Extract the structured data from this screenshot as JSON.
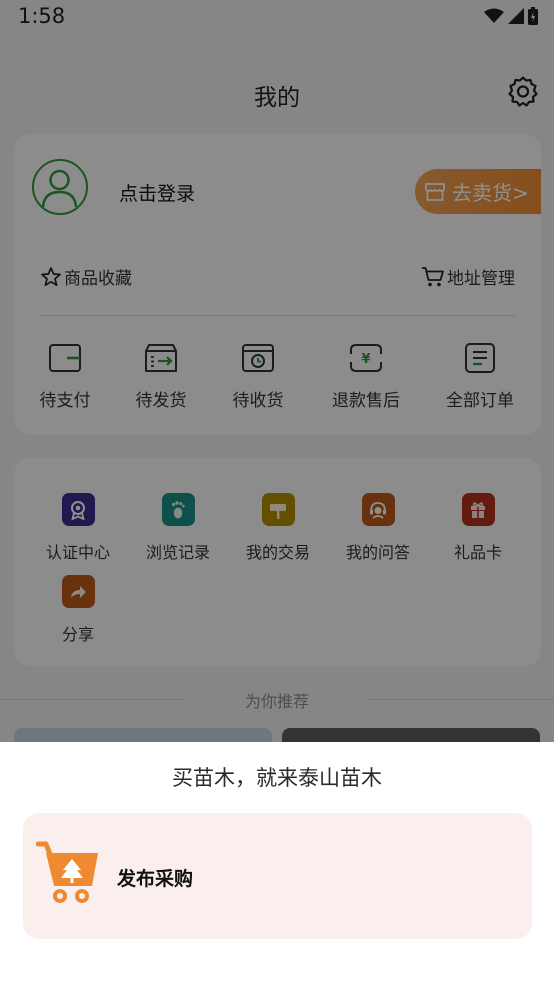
{
  "status_bar": {
    "time": "1:58"
  },
  "header": {
    "title": "我的"
  },
  "account": {
    "login_text": "点击登录",
    "sell_button": "去卖货>",
    "favorites_label": "商品收藏",
    "address_label": "地址管理"
  },
  "orders": [
    {
      "label": "待支付",
      "icon": "wallet-icon"
    },
    {
      "label": "待发货",
      "icon": "shipping-box-icon"
    },
    {
      "label": "待收货",
      "icon": "receive-box-icon"
    },
    {
      "label": "退款售后",
      "icon": "refund-icon"
    },
    {
      "label": "全部订单",
      "icon": "order-list-icon"
    }
  ],
  "services": [
    {
      "label": "认证中心",
      "icon": "certification-icon",
      "color": "#3b2d8f"
    },
    {
      "label": "浏览记录",
      "icon": "footprint-icon",
      "color": "#1d8f84"
    },
    {
      "label": "我的交易",
      "icon": "signpost-icon",
      "color": "#b38c00"
    },
    {
      "label": "我的问答",
      "icon": "customer-service-icon",
      "color": "#b95a1a"
    },
    {
      "label": "礼品卡",
      "icon": "gift-icon",
      "color": "#b3321c"
    },
    {
      "label": "分享",
      "icon": "share-icon",
      "color": "#b95a1a"
    }
  ],
  "recommend_title": "为你推荐",
  "sheet": {
    "title": "买苗木，就来泰山苗木",
    "option_label": "发布采购",
    "option_icon": "shopping-cart-tree-icon"
  },
  "colors": {
    "brand_green": "#2f9a3a",
    "sell_orange": "#ee8b32",
    "sheet_option_bg": "#fbefed"
  }
}
